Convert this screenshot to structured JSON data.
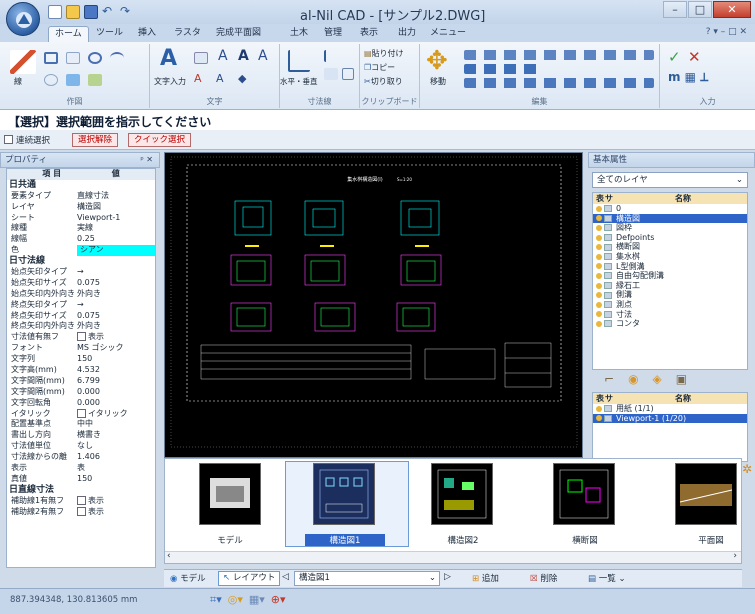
{
  "window": {
    "title": "al-Nil CAD - [サンプル2.DWG]"
  },
  "ribbon_tabs": [
    "ホーム",
    "ツール",
    "挿入",
    "ラスタ",
    "完成平面図",
    "土木",
    "管理",
    "表示",
    "出力",
    "メニュー"
  ],
  "active_tab": "ホーム",
  "ribbon_groups": {
    "draw": "作図",
    "text": "文字",
    "dimension": "寸法線",
    "clipboard": "クリップボード",
    "edit": "編集",
    "input": "入力"
  },
  "ribbon_labels": {
    "line": "線",
    "text_input": "文字入力",
    "horizontal_vertical": "水平・垂直",
    "paste": "貼り付け",
    "copy": "コピー",
    "cut": "切り取り",
    "move": "移動"
  },
  "instruction": "【選択】選択範囲を指示してください",
  "options": {
    "continuous_select": "連続選択",
    "deselect": "選択解除",
    "quick_select": "クイック選択"
  },
  "properties_panel": {
    "title": "プロパティ",
    "header": [
      "項 目",
      "値"
    ],
    "rows": [
      {
        "section": "日共通"
      },
      {
        "k": "要素タイプ",
        "v": "直線寸法"
      },
      {
        "k": "レイヤ",
        "v": "構造図"
      },
      {
        "k": "シート",
        "v": "Viewport-1"
      },
      {
        "k": "線種",
        "v": "実線"
      },
      {
        "k": "線幅",
        "v": "0.25"
      },
      {
        "k": "色",
        "v": "シアン"
      },
      {
        "section": "日寸法線"
      },
      {
        "k": "始点矢印タイプ",
        "v": "→"
      },
      {
        "k": "始点矢印サイズ",
        "v": "0.075"
      },
      {
        "k": "始点矢印内外向き",
        "v": "外向き"
      },
      {
        "k": "終点矢印タイプ",
        "v": "→"
      },
      {
        "k": "終点矢印サイズ",
        "v": "0.075"
      },
      {
        "k": "終点矢印内外向き",
        "v": "外向き"
      },
      {
        "k": "寸法値有無フ",
        "v": "表示"
      },
      {
        "k": "フォント",
        "v": "MS ゴシック"
      },
      {
        "k": "文字列",
        "v": "150"
      },
      {
        "k": "文字高(mm)",
        "v": "4.532"
      },
      {
        "k": "文字間隔(mm)",
        "v": "6.799"
      },
      {
        "k": "文字間隔(mm)",
        "v": "0.000"
      },
      {
        "k": "文字回転角",
        "v": "0.000"
      },
      {
        "k": "イタリック",
        "v": "イタリック"
      },
      {
        "k": "配置基準点",
        "v": "中中"
      },
      {
        "k": "書出し方向",
        "v": "横書き"
      },
      {
        "k": "寸法値単位",
        "v": "なし"
      },
      {
        "k": "寸法線からの離",
        "v": "1.406"
      },
      {
        "k": "表示",
        "v": "表"
      },
      {
        "k": "真値",
        "v": "150"
      },
      {
        "section": "日直線寸法"
      },
      {
        "k": "補助線1有無フ",
        "v": "表示"
      },
      {
        "k": "補助線2有無フ",
        "v": "表示"
      }
    ]
  },
  "drawing": {
    "title": "集水桝構造図(I)",
    "scale": "S=1:20"
  },
  "basic_attr": {
    "title": "基本属性",
    "layer_filter": "全てのレイヤ",
    "layer_header": [
      "表",
      "サ",
      "名称"
    ],
    "layers": [
      "0",
      "構造図",
      "図枠",
      "Defpoints",
      "横断図",
      "集水桝",
      "L型側溝",
      "自由勾配側溝",
      "縁石工",
      "側溝",
      "測点",
      "寸法",
      "コンタ"
    ],
    "selected_layer": "構造図",
    "viewport_header": [
      "表",
      "サ",
      "名称"
    ],
    "viewports": [
      "用紙 (1/1)",
      "Viewport-1 (1/20)"
    ],
    "selected_viewport": "Viewport-1 (1/20)"
  },
  "thumbnails": [
    "モデル",
    "構造図1",
    "構造図2",
    "横断図",
    "平面図"
  ],
  "selected_thumbnail": "構造図1",
  "bottom_bar": {
    "model": "モデル",
    "layout": "レイアウト",
    "current_sheet": "構造図1",
    "add": "追加",
    "delete": "削除",
    "list": "一覧"
  },
  "status": {
    "coords": "887.394348, 130.813605 mm"
  },
  "colors": {
    "accent": "#2e64c8",
    "canvas": "#000000",
    "cyan": "#00ffff",
    "magenta": "#ff44ff",
    "green": "#22ff55",
    "yellow": "#ffee00"
  }
}
